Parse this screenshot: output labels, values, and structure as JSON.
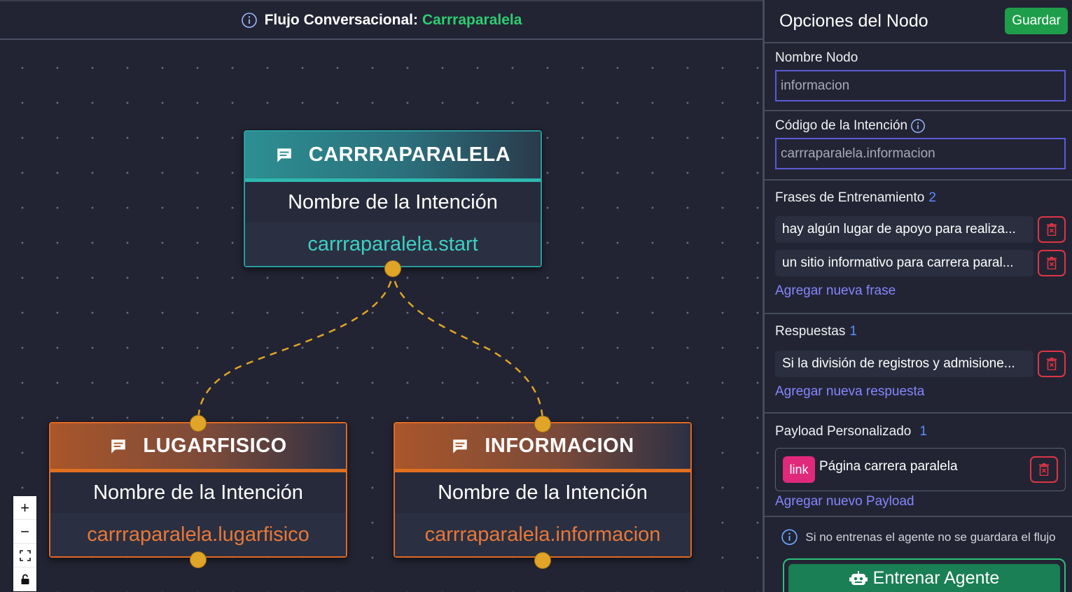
{
  "topbar": {
    "prefix": "Flujo Conversacional:",
    "flow_name": "Carrraparalela"
  },
  "nodes": {
    "root": {
      "title": "CARRRAPARALELA",
      "label": "Nombre de la Intención",
      "code": "carrraparalela.start"
    },
    "left": {
      "title": "LUGARFISICO",
      "label": "Nombre de la Intención",
      "code": "carrraparalela.lugarfisico"
    },
    "right": {
      "title": "INFORMACION",
      "label": "Nombre de la Intención",
      "code": "carrraparalela.informacion"
    }
  },
  "controls": {
    "zoom_in": "+",
    "zoom_out": "−",
    "fit": "⛶",
    "lock": "🔒"
  },
  "panel": {
    "title": "Opciones del Nodo",
    "save": "Guardar",
    "node_name": {
      "label": "Nombre Nodo",
      "value": "informacion"
    },
    "intent_code": {
      "label": "Código de la Intención",
      "value": "carrraparalela.informacion"
    },
    "phrases": {
      "label": "Frases de Entrenamiento",
      "count": "2",
      "items": [
        "hay algún lugar de apoyo para realiza...",
        "un sitio informativo para carrera paral..."
      ],
      "add": "Agregar nueva frase"
    },
    "responses": {
      "label": "Respuestas",
      "count": "1",
      "items": [
        "Si la división de registros y admisione..."
      ],
      "add": "Agregar nueva respuesta"
    },
    "payload": {
      "label": "Payload Personalizado",
      "count": "1",
      "badge": "link",
      "text": "Página carrera paralela",
      "add": "Agregar nuevo Payload"
    },
    "notice": "Si no entrenas el agente no se guardara el flujo",
    "train": "Entrenar Agente"
  },
  "colors": {
    "accent_green": "#2ecc71",
    "teal": "#2a9ca0",
    "orange": "#e06a27",
    "handle": "#e0a528",
    "danger": "#dc3545",
    "link": "#8585ff"
  }
}
